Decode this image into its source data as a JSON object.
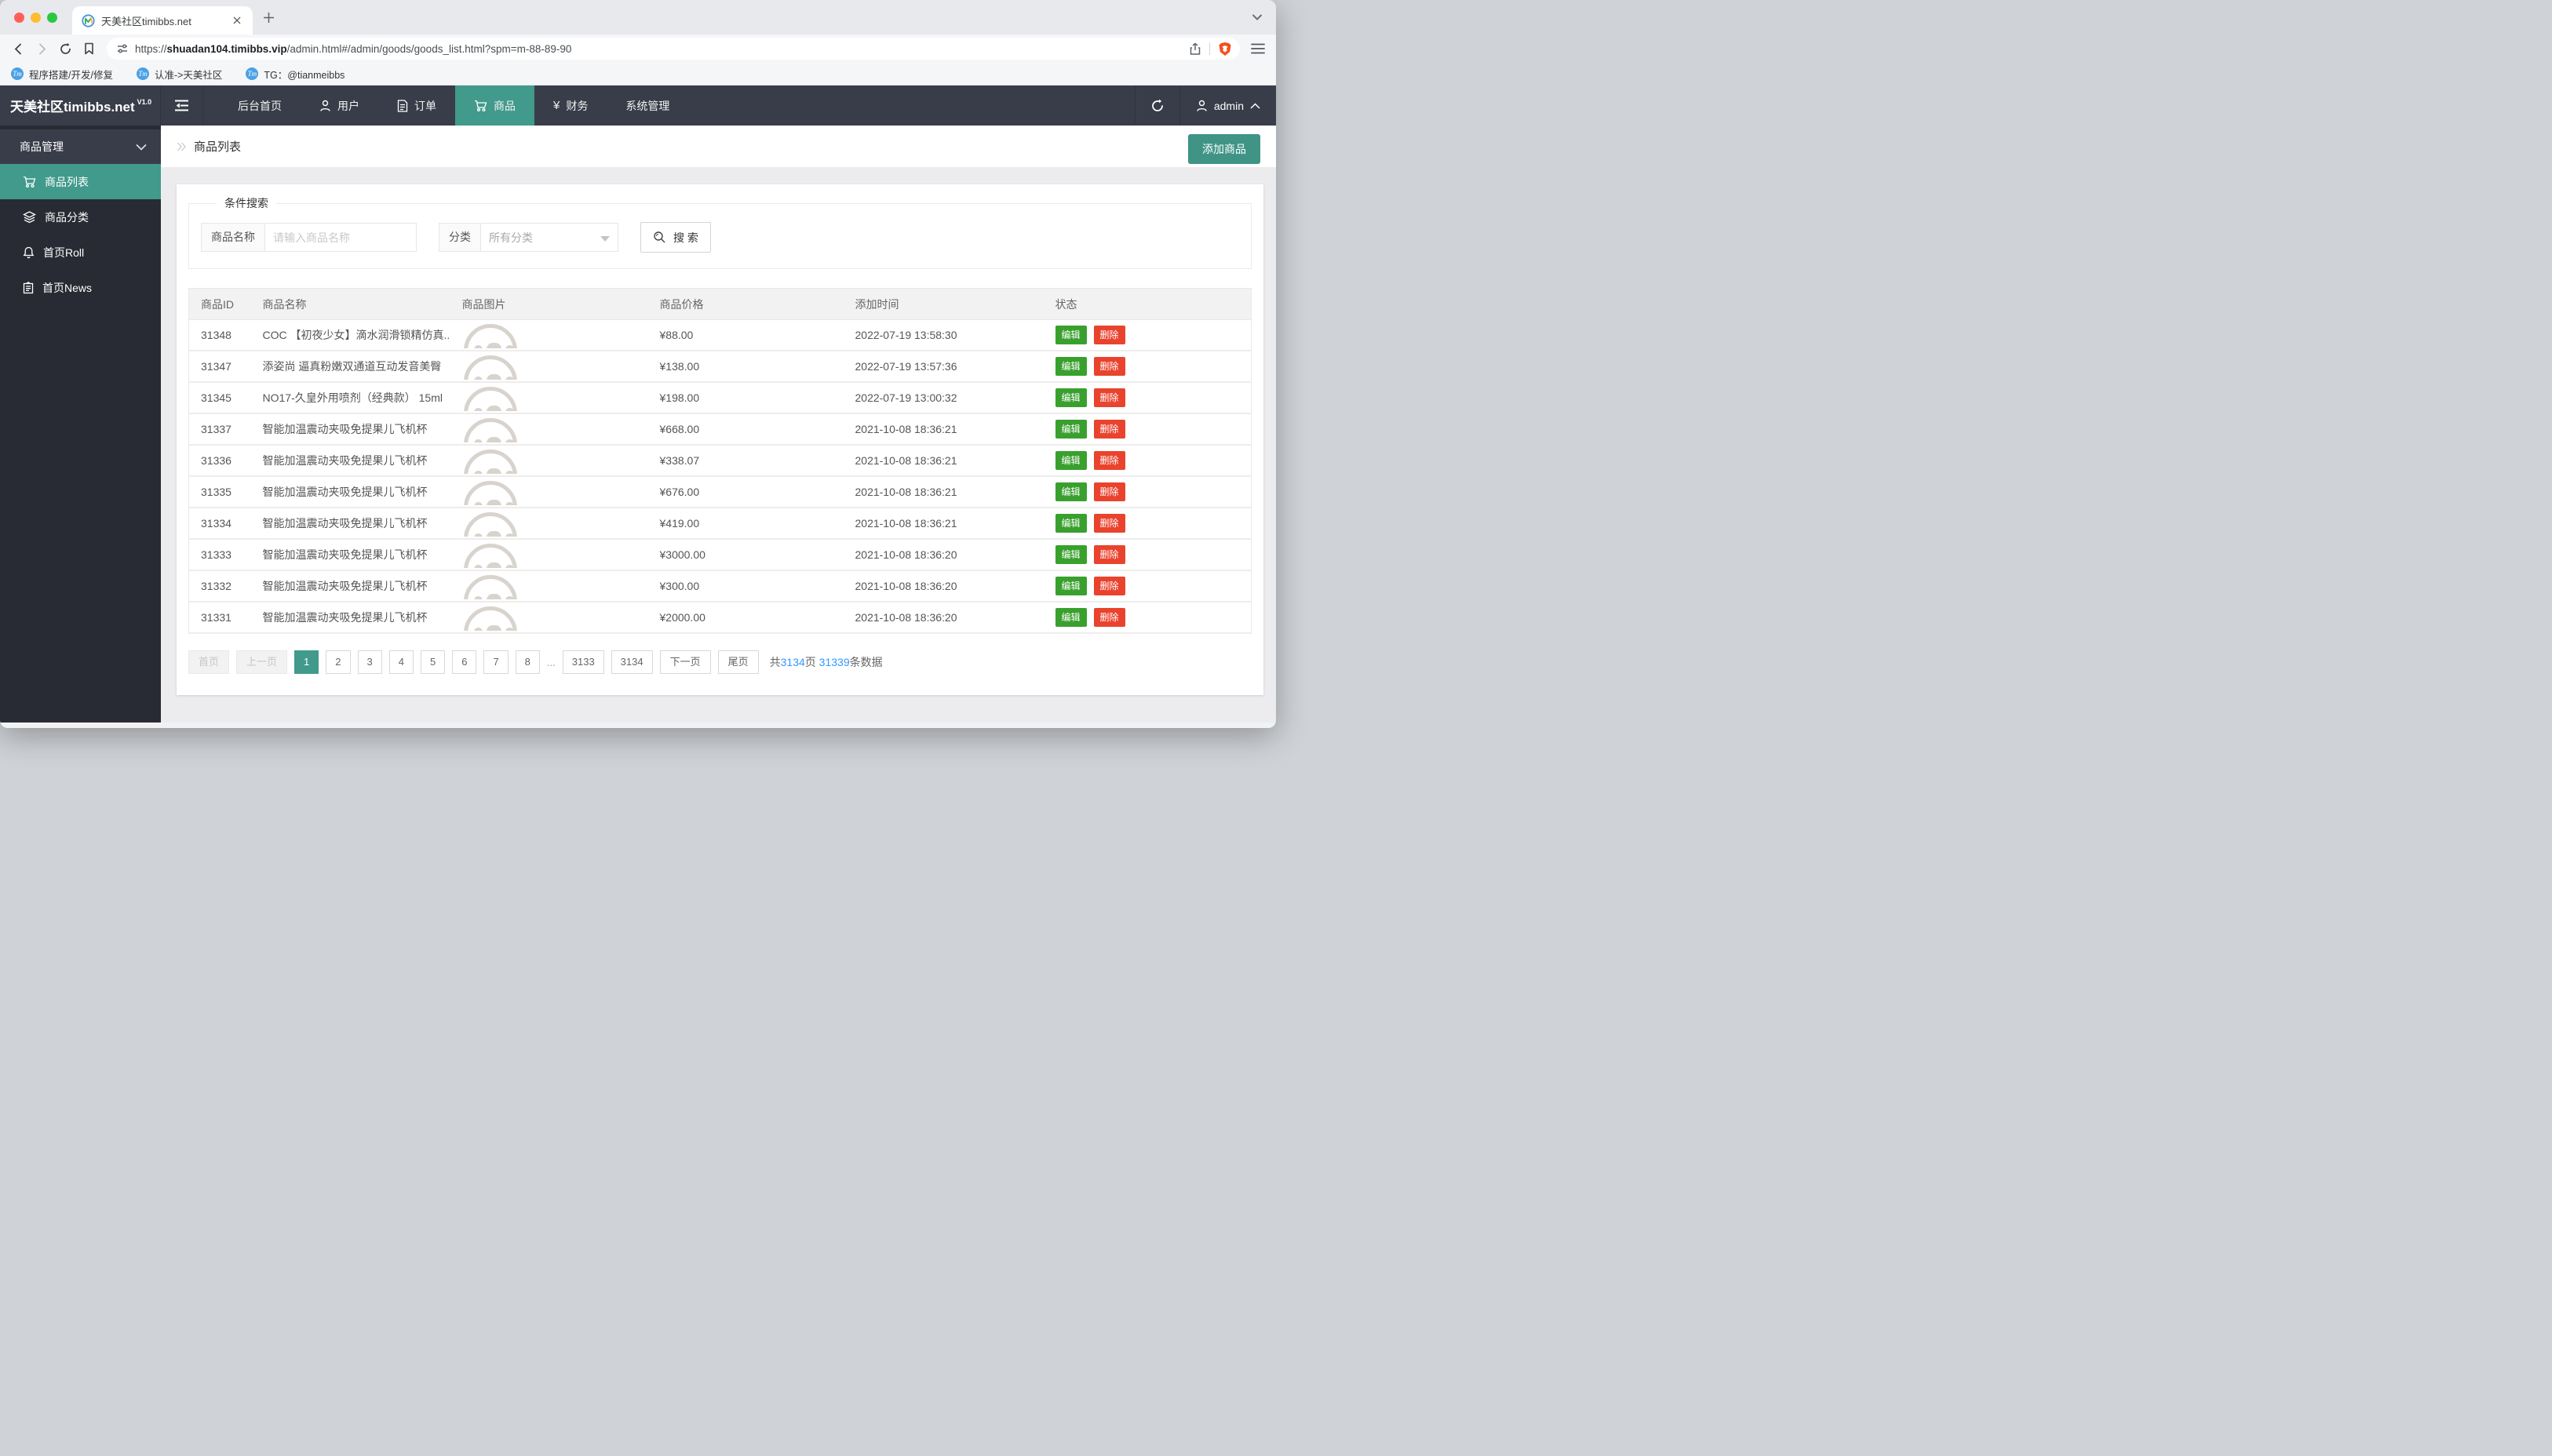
{
  "browser": {
    "tab": {
      "title": "天美社区timibbs.net"
    },
    "url": {
      "scheme": "https://",
      "domain": "shuadan104.timibbs.vip",
      "path": "/admin.html#/admin/goods/goods_list.html?spm=m-88-89-90"
    },
    "bookmarks": [
      {
        "icon_text": "Tm",
        "label": "程序搭建/开发/修复"
      },
      {
        "icon_text": "Tm",
        "label": "认准->天美社区"
      },
      {
        "icon_text": "Tm",
        "label": "TG：@tianmeibbs"
      }
    ]
  },
  "topnav": {
    "logo": "天美社区timibbs.net",
    "version": "V1.0",
    "items": [
      {
        "label": "后台首页"
      },
      {
        "label": "用户"
      },
      {
        "label": "订单"
      },
      {
        "label": "商品"
      },
      {
        "label": "财务"
      },
      {
        "label": "系统管理"
      }
    ],
    "yen_icon": "¥",
    "user": "admin"
  },
  "sidebar": {
    "group": "商品管理",
    "items": [
      {
        "label": "商品列表"
      },
      {
        "label": "商品分类"
      },
      {
        "label": "首页Roll"
      },
      {
        "label": "首页News"
      }
    ]
  },
  "page": {
    "breadcrumb": "商品列表",
    "add_button": "添加商品",
    "search": {
      "legend": "条件搜索",
      "name_label": "商品名称",
      "name_placeholder": "请输入商品名称",
      "category_label": "分类",
      "category_value": "所有分类",
      "search_button": "搜 索"
    }
  },
  "table": {
    "headers": [
      "商品ID",
      "商品名称",
      "商品图片",
      "商品价格",
      "添加时间",
      "状态"
    ],
    "edit_label": "编辑",
    "delete_label": "删除",
    "rows": [
      {
        "id": "31348",
        "name": "COC 【初夜少女】滴水润滑锁精仿真...",
        "price": "¥88.00",
        "time": "2022-07-19 13:58:30"
      },
      {
        "id": "31347",
        "name": "添姿尚 逼真粉嫩双通道互动发音美臀",
        "price": "¥138.00",
        "time": "2022-07-19 13:57:36"
      },
      {
        "id": "31345",
        "name": "NO17-久皇外用喷剂（经典款） 15ml",
        "price": "¥198.00",
        "time": "2022-07-19 13:00:32"
      },
      {
        "id": "31337",
        "name": "智能加温震动夹吸免提果儿飞机杯",
        "price": "¥668.00",
        "time": "2021-10-08 18:36:21"
      },
      {
        "id": "31336",
        "name": "智能加温震动夹吸免提果儿飞机杯",
        "price": "¥338.07",
        "time": "2021-10-08 18:36:21"
      },
      {
        "id": "31335",
        "name": "智能加温震动夹吸免提果儿飞机杯",
        "price": "¥676.00",
        "time": "2021-10-08 18:36:21"
      },
      {
        "id": "31334",
        "name": "智能加温震动夹吸免提果儿飞机杯",
        "price": "¥419.00",
        "time": "2021-10-08 18:36:21"
      },
      {
        "id": "31333",
        "name": "智能加温震动夹吸免提果儿飞机杯",
        "price": "¥3000.00",
        "time": "2021-10-08 18:36:20"
      },
      {
        "id": "31332",
        "name": "智能加温震动夹吸免提果儿飞机杯",
        "price": "¥300.00",
        "time": "2021-10-08 18:36:20"
      },
      {
        "id": "31331",
        "name": "智能加温震动夹吸免提果儿飞机杯",
        "price": "¥2000.00",
        "time": "2021-10-08 18:36:20"
      }
    ]
  },
  "pagination": {
    "first": "首页",
    "prev": "上一页",
    "pages": [
      "1",
      "2",
      "3",
      "4",
      "5",
      "6",
      "7",
      "8"
    ],
    "ellipsis": "...",
    "tail_pages": [
      "3133",
      "3134"
    ],
    "next": "下一页",
    "last": "尾页",
    "summary": {
      "prefix": "共",
      "total_pages": "3134",
      "mid": "页 ",
      "total_items": "31339",
      "suffix": "条数据"
    }
  },
  "colors": {
    "teal": "#419a8b",
    "green": "#39a02e",
    "red": "#e9432e",
    "blue": "#3398ff",
    "nav_bg": "#393d49"
  }
}
